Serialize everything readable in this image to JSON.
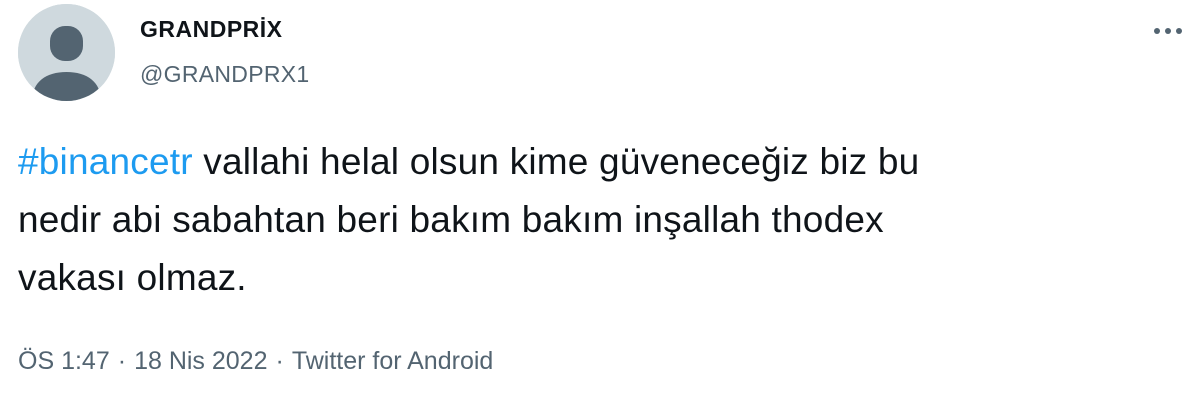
{
  "user": {
    "display_name": "GRANDPRİX",
    "handle": "@GRANDPRX1",
    "avatar": "default-profile-icon"
  },
  "more_icon": "more-horizontal-icon",
  "tweet": {
    "hashtag": "#binancetr",
    "line1_rest": " vallahi helal olsun kime güveneceğiz biz bu",
    "line2": "nedir abi sabahtan beri bakım bakım inşallah thodex",
    "line3": "vakası olmaz."
  },
  "meta": {
    "time": "ÖS 1:47",
    "separator": "·",
    "date": "18 Nis 2022",
    "source": "Twitter for Android"
  },
  "colors": {
    "link": "#1d9bf0",
    "secondary_text": "#536471",
    "primary_text": "#0f1419",
    "avatar_bg": "#cfd9de",
    "avatar_fg": "#536471"
  }
}
